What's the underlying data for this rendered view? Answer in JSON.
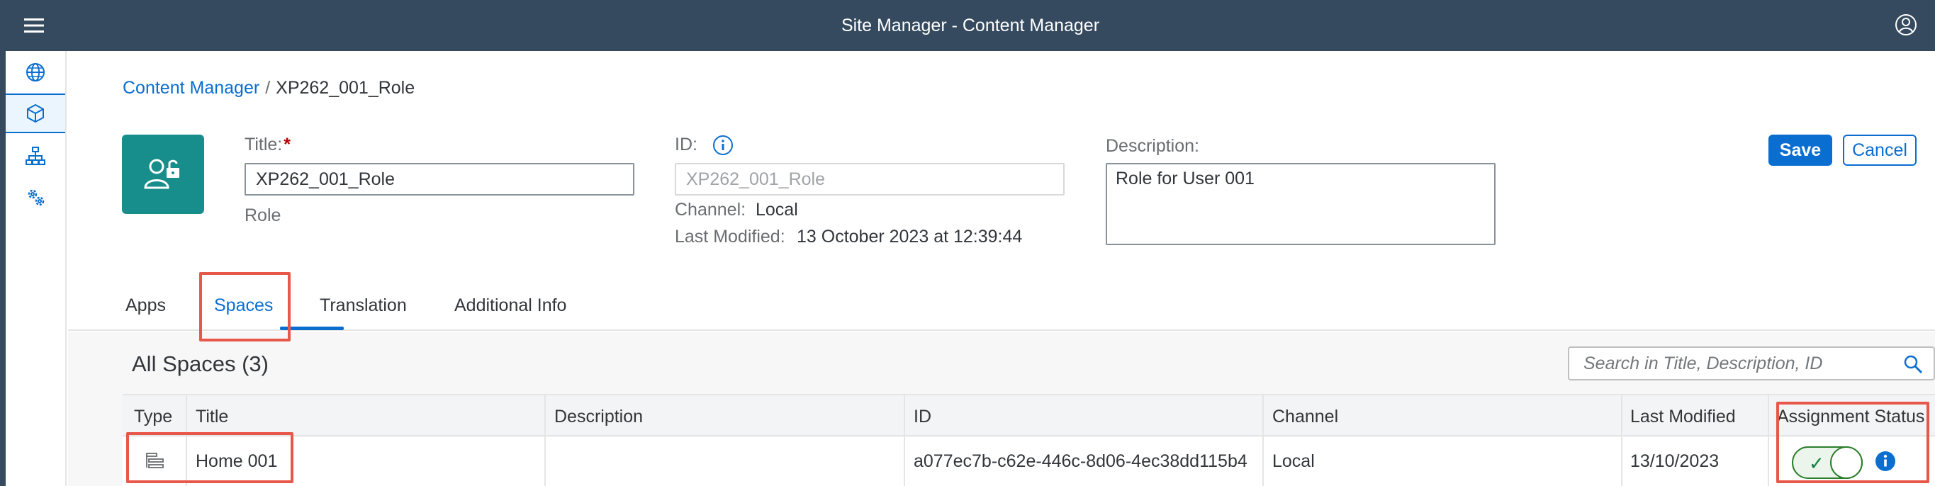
{
  "shell": {
    "title": "Site Manager - Content Manager",
    "menu_icon": "menu-icon",
    "user_icon": "user-icon"
  },
  "sidenav": {
    "items": [
      {
        "icon": "globe-icon",
        "active": false
      },
      {
        "icon": "cube-icon",
        "active": true
      },
      {
        "icon": "hierarchy-icon",
        "active": false
      },
      {
        "icon": "gears-icon",
        "active": false
      }
    ]
  },
  "breadcrumb": {
    "link": "Content Manager",
    "separator": "/",
    "current": "XP262_001_Role"
  },
  "header": {
    "title_label": "Title:",
    "title_required": "*",
    "title_value": "XP262_001_Role",
    "type_text": "Role",
    "id_label": "ID:",
    "id_value": "XP262_001_Role",
    "channel_label": "Channel:",
    "channel_value": "Local",
    "last_modified_label": "Last Modified:",
    "last_modified_value": "13 October 2023 at 12:39:44",
    "description_label": "Description:",
    "description_value": "Role for User 001",
    "save_label": "Save",
    "cancel_label": "Cancel"
  },
  "tabs": [
    {
      "label": "Apps",
      "selected": false
    },
    {
      "label": "Spaces",
      "selected": true
    },
    {
      "label": "Translation",
      "selected": false
    },
    {
      "label": "Additional Info",
      "selected": false
    }
  ],
  "spaces": {
    "section_title": "All Spaces (3)",
    "search_placeholder": "Search in Title, Description, ID",
    "columns": [
      "Type",
      "Title",
      "Description",
      "ID",
      "Channel",
      "Last Modified",
      "Assignment Status"
    ],
    "rows": [
      {
        "type_icon": "space-icon",
        "title": "Home 001",
        "description": "",
        "id": "a077ec7b-c62e-446c-8d06-4ec38dd115b4",
        "channel": "Local",
        "last_modified": "13/10/2023",
        "assigned": true
      }
    ]
  },
  "colors": {
    "shell": "#354a5f",
    "accent": "#0a6ed1",
    "role_tile": "#188e8c",
    "highlight": "#e8584a",
    "positive": "#107e3e"
  }
}
